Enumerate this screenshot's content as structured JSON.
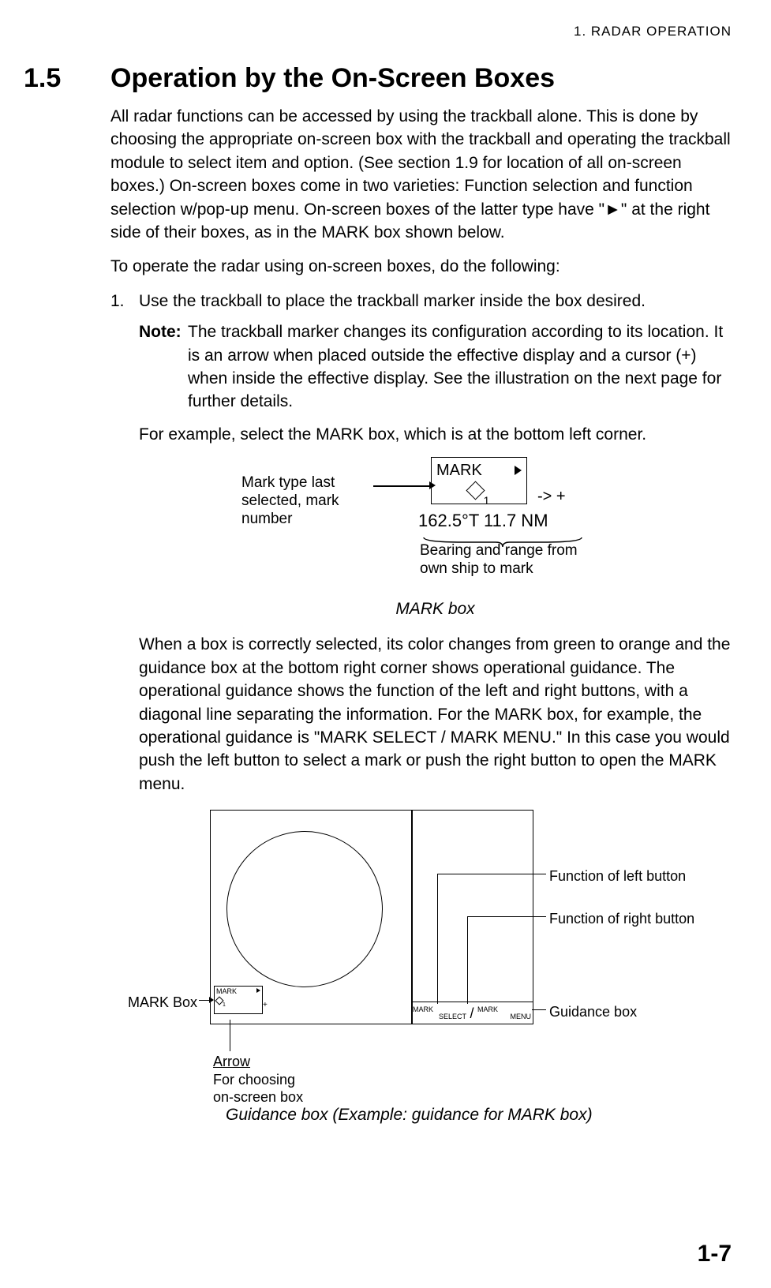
{
  "running_head": "1.  RADAR  OPERATION",
  "section": {
    "number": "1.5",
    "title": "Operation by the On-Screen Boxes"
  },
  "intro": "All radar functions can be accessed by using the trackball alone. This is done by choosing the appropriate on-screen box with the trackball and operating the trackball module to select item and option. (See section 1.9 for location of all on-screen boxes.) On-screen boxes come in two varieties: Function selection and function selection w/pop-up menu. On-screen boxes of the latter type have \"►\" at the right side of their boxes, as in the MARK box shown below.",
  "lead_in": "To operate the radar using on-screen boxes, do the following:",
  "step1": {
    "num": "1.",
    "text": "Use the trackball to place the trackball marker inside the box desired."
  },
  "note": {
    "label": "Note:",
    "text": "The trackball marker changes its configuration according to its location. It is an arrow when placed outside the effective display and a cursor (+) when inside the effective display. See the illustration on the next page for further details."
  },
  "example_line": "For example, select the MARK box, which is at the bottom left corner.",
  "fig1": {
    "callout": "Mark type last\nselected, mark\nnumber",
    "box_label": "MARK",
    "mark_number": "1",
    "cursor_hint": "-> +",
    "bearing_range": "162.5°T  11.7 NM",
    "brace_label": "Bearing and range from\nown ship to mark",
    "caption": "MARK box"
  },
  "after_fig1": "When a box is correctly selected, its color changes from green to orange and the guidance box at the bottom right corner shows operational guidance. The operational guidance shows the function of the left and right buttons, with a diagonal line separating the information. For the MARK box, for example, the operational guidance is \"MARK SELECT / MARK MENU.\" In this case you would push the left button to select a mark or push the right button to open the MARK menu.",
  "fig2": {
    "mark_box_label": "MARK Box",
    "mini_mark": "MARK",
    "mini_cursor": "+",
    "guidance_left_1": "MARK",
    "guidance_left_2": "SELECT",
    "guidance_right_1": "MARK",
    "guidance_right_2": "MENU",
    "fn_left": "Function of left button",
    "fn_right": "Function of right button",
    "gbox_label": "Guidance box",
    "arrow_title": "Arrow",
    "arrow_desc": "For choosing\non-screen box",
    "caption": "Guidance box (Example: guidance for MARK box)"
  },
  "page_number": "1-7"
}
